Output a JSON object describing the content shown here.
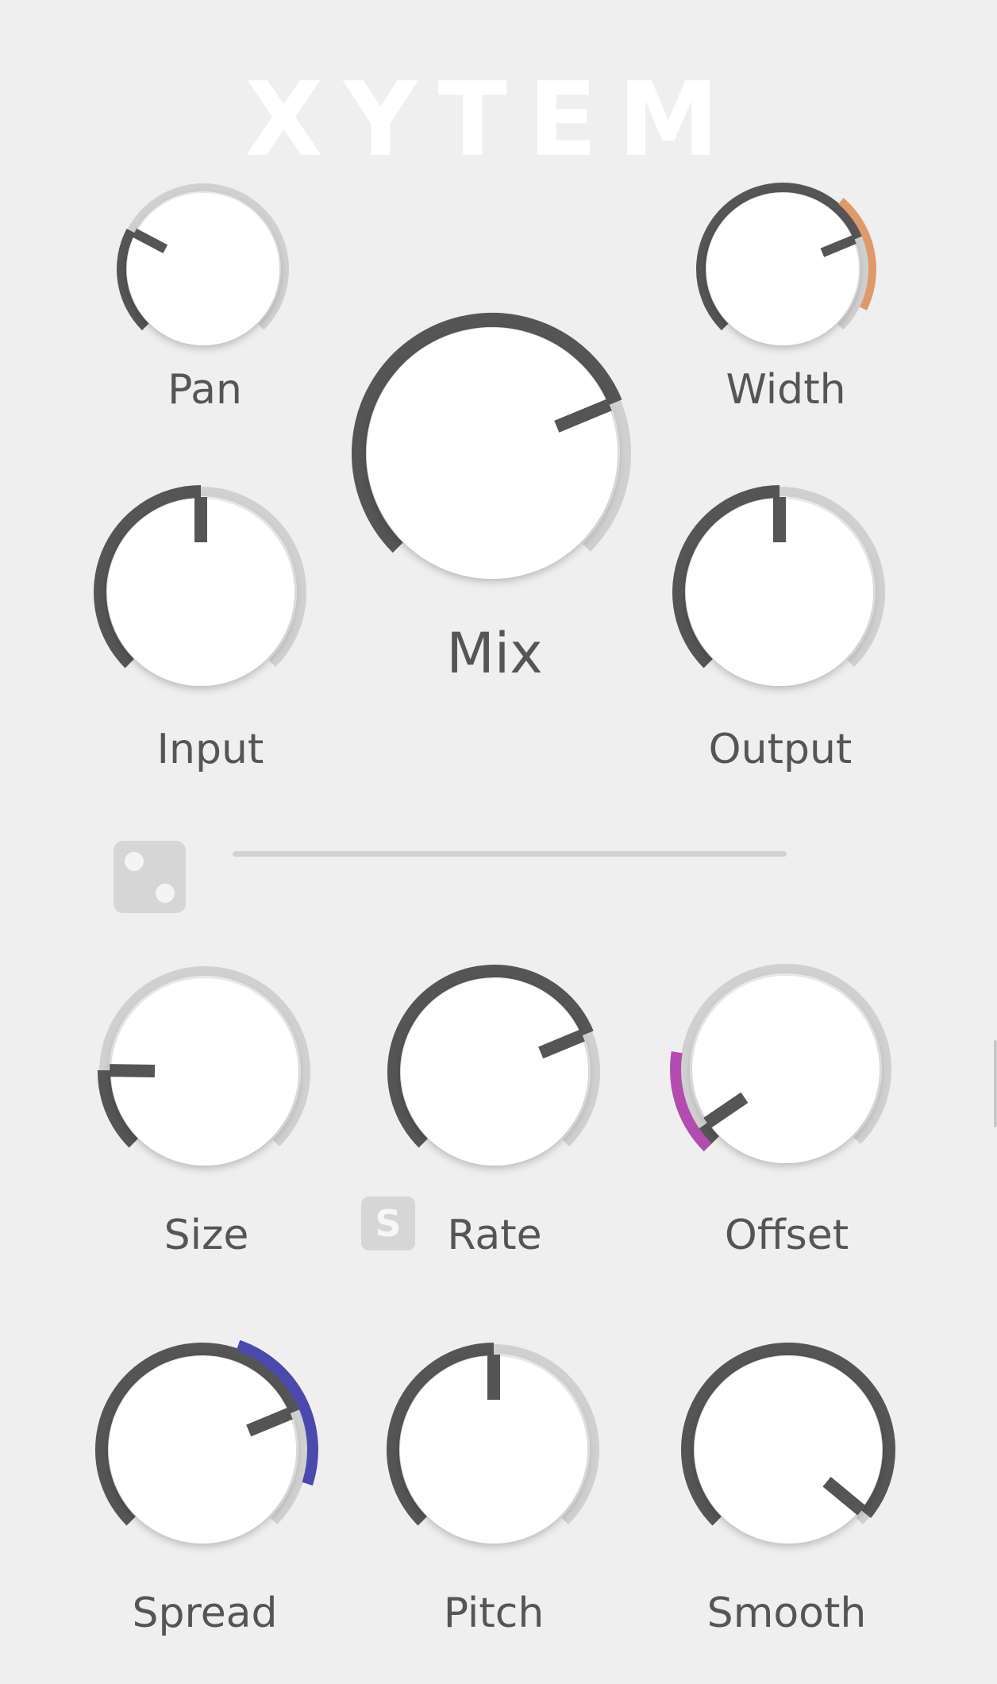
{
  "app": {
    "title": "XYTEM"
  },
  "colors": {
    "background": "#efefef",
    "knob_face": "#ffffff",
    "track": "#d0d0d0",
    "value_arc": "#555555",
    "label": "#555555",
    "width_mod": "#e0996a",
    "offset_mod": "#b44bb0",
    "spread_mod": "#4a4aac"
  },
  "knobs": [
    {
      "id": "pan",
      "label": "Pan",
      "value": 0.27
    },
    {
      "id": "width",
      "label": "Width",
      "value": 0.75,
      "mod": {
        "from": 0.65,
        "to": 0.93,
        "color": "width_mod"
      }
    },
    {
      "id": "mix",
      "label": "Mix",
      "value": 0.75
    },
    {
      "id": "input",
      "label": "Input",
      "value": 0.5
    },
    {
      "id": "output",
      "label": "Output",
      "value": 0.5
    },
    {
      "id": "size",
      "label": "Size",
      "value": 0.17
    },
    {
      "id": "rate",
      "label": "Rate",
      "value": 0.75
    },
    {
      "id": "offset",
      "label": "Offset",
      "value": 0.04,
      "mod": {
        "from": 0.0,
        "to": 0.2,
        "color": "offset_mod"
      }
    },
    {
      "id": "spread",
      "label": "Spread",
      "value": 0.75,
      "mod": {
        "from": 0.57,
        "to": 0.9,
        "color": "spread_mod"
      }
    },
    {
      "id": "pitch",
      "label": "Pitch",
      "value": 0.5
    },
    {
      "id": "smooth",
      "label": "Smooth",
      "value": 0.98
    }
  ],
  "randomize": {
    "icon": "dice-icon"
  },
  "sync": {
    "label": "S",
    "icon": "sync-icon"
  },
  "slider": {
    "value": 0
  }
}
